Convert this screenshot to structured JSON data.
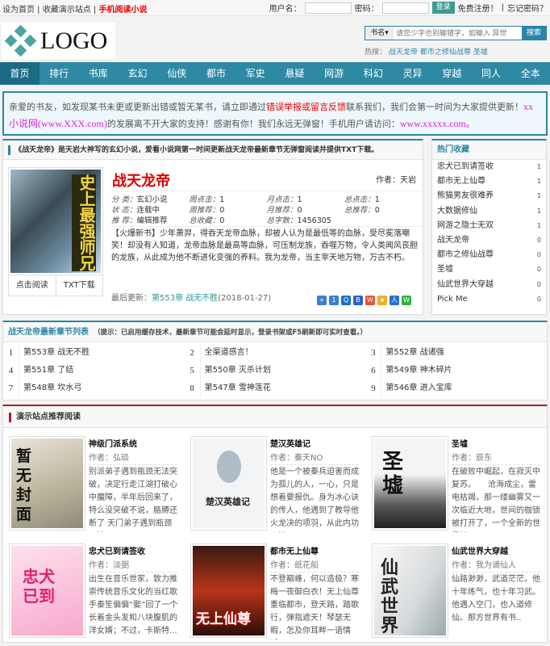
{
  "topbar": {
    "set_home": "设为首页",
    "bookmark": "收藏演示站点",
    "mobile": "手机阅读小说",
    "username_label": "用户名：",
    "password_label": "密码：",
    "login": "登录",
    "register": "免费注册！",
    "forgot": "忘记密码？"
  },
  "logo": "LOGO",
  "search": {
    "type": "书名",
    "placeholder": "请您少字也别输错字，如输入 异世",
    "button": "搜索",
    "hot_label": "热搜：",
    "hot": [
      "战天龙帝",
      "都市之修仙战尊",
      "圣墟"
    ]
  },
  "nav": [
    "首页",
    "排行",
    "书库",
    "玄幻",
    "仙侠",
    "都市",
    "军史",
    "悬疑",
    "网游",
    "科幻",
    "灵异",
    "穿越",
    "同人",
    "全本"
  ],
  "notice": {
    "p1": "亲爱的书友，如发现某书未更或更新出错或暂无某书，请立即通过",
    "link": "错误举报或留言反馈",
    "p2": "联系我们，我们会第一时间为大家提供更新！",
    "site": "xx小说网(www.XXX.com)",
    "p3": "的发展离不开大家的支持！感谢有你！我们永远无弹窗！手机用户请访问：",
    "mobile": "www.xxxxx.com。"
  },
  "book": {
    "header": "《战天龙帝》是天岩大神写的玄幻小说，爱看小说网第一时间更新战天龙帝最新章节无弹窗阅读并提供TXT下载。",
    "cover_text": "史上最强师兄",
    "title": "战天龙帝",
    "author": "作者：天岩",
    "meta": [
      [
        "分  类：",
        "玄幻小说",
        "周点击：",
        "1",
        "月点击：",
        "1",
        "总点击：",
        "1"
      ],
      [
        "状  态：",
        "连载中",
        "周推荐：",
        "0",
        "月推荐：",
        "0",
        "总推荐：",
        "0"
      ],
      [
        "推  荐：",
        "编辑推荐",
        "总收藏：",
        "0",
        "总字数：",
        "1456305",
        "",
        ""
      ]
    ],
    "intro": "【火爆新书】少年萧羿，得吞天龙帝血脉，却被人认为是最低等的血脉，受尽冕落嘲笑！却没有人知道，龙帝血脉是最高等血脉，可压制龙族，吞噬万物，令人类闻风丧胆的龙族，从此成为他不断进化变强的养料。我为龙帝，当主宰天地万物，万古不朽。",
    "read": "点击阅读",
    "txt": "TXT下载",
    "last_label": "最后更新：",
    "last_chapter": "第553章 战无不胜",
    "last_date": "(2018-01-27)"
  },
  "sidebar": {
    "title": "热门收藏",
    "items": [
      [
        "忠犬已到请签收",
        "1"
      ],
      [
        "都市无上仙尊",
        "1"
      ],
      [
        "熊猫男友很难养",
        "1"
      ],
      [
        "大数据修仙",
        "1"
      ],
      [
        "网游之隐士无双",
        "1"
      ],
      [
        "战天龙帝",
        "0"
      ],
      [
        "都市之修仙战尊",
        "0"
      ],
      [
        "圣墟",
        "0"
      ],
      [
        "仙武世界大穿越",
        "0"
      ],
      [
        "Pick Me",
        "0"
      ]
    ]
  },
  "chapters": {
    "title": "战天龙帝最新章节列表",
    "tip": "（提示：已启用缓存技术，最新章节可能会延时显示，登录书架或F5刷新即可实时查看。）",
    "items": [
      [
        "1",
        "第553章 战无不胜"
      ],
      [
        "2",
        "全渠道感言！"
      ],
      [
        "3",
        "第552章 战诸强"
      ],
      [
        "4",
        "第551章 了结"
      ],
      [
        "5",
        "第550章 灭杀计划"
      ],
      [
        "6",
        "第549章 神木碎片"
      ],
      [
        "7",
        "第548章 坎水弓"
      ],
      [
        "8",
        "第547章 雪神莲花"
      ],
      [
        "9",
        "第546章 进入宝库"
      ]
    ]
  },
  "recommend": {
    "title": "演示站点推荐阅读",
    "items": [
      {
        "title": "神级门派系统",
        "author": "作者：弘琰",
        "desc": "别派弟子遇到瓶颈无法突破，决定行走江湖打破心中魔障，半年后回来了，特么没突破不说，胳膊还断了 天门弟子遇到瓶颈无法...",
        "cover": "暂无封面"
      },
      {
        "title": "楚汉英雄记",
        "author": "作者：秦天NO",
        "desc": "他是一个被秦兵迫害而成为孤儿的人，一心，只是想着要报仇。身为冰心诀的传人，他遇到了教导他火龙决的项羽，从此内功心法，...",
        "cover": "楚汉英雄记"
      },
      {
        "title": "圣墟",
        "author": "作者：辰东",
        "desc": "在破败中崛起，在寂灭中复苏。　　沧海成尘，雷电枯竭，那一缕幽雾又一次临近大地，世间的枷锁被打开了，一个全新的世界就...",
        "cover": "圣墟"
      },
      {
        "title": "忠犬已到请签收",
        "author": "作者：淡弼",
        "desc": "出生在音乐世家，致力推崇传统音乐文化的当红歌手秦笙偏偏“娶”回了一个长着金头发和八块腹肌的洋女婿；不过，卡斯特...",
        "cover": "忠犬已到"
      },
      {
        "title": "都市无上仙尊",
        "author": "作者：纸花船",
        "desc": "不登巅峰，何以造极？寒梅一夜御白衣！无上仙尊重临都市，登天路，踏歌行，弹指遮天！琴瑟无暇，怎及你耳畔一语情话？...",
        "cover": "无上仙尊"
      },
      {
        "title": "仙武世界大穿越",
        "author": "作者：我为谪仙人",
        "desc": "仙路渺渺，武道茫茫。他十年练气，也十年习武。他遇入空门，也入道修仙。那方世界有书..",
        "cover": "仙武世界"
      }
    ]
  }
}
